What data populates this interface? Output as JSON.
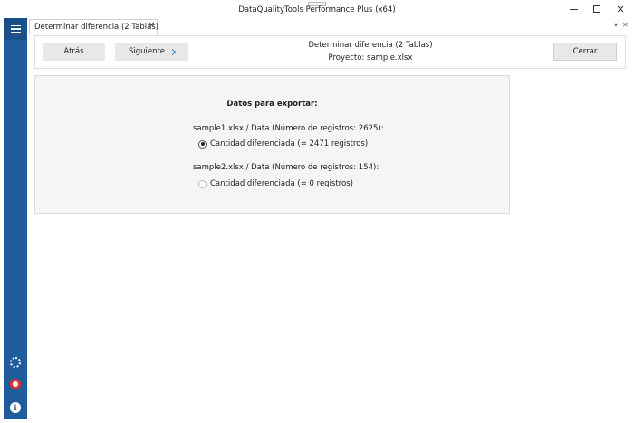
{
  "window": {
    "title": "DataQualityTools Performance Plus (x64)",
    "minimize_label": "",
    "maximize_label": "",
    "close_label": "✕"
  },
  "sidebar": {
    "icons": [
      "menu-icon",
      "gear-icon",
      "help-icon",
      "info-icon"
    ],
    "info_glyph": "i",
    "accent": "#1f5c9c"
  },
  "tabs": [
    {
      "label": "Determinar diferencia (2 Tablas)",
      "close": "✕"
    }
  ],
  "tab_tools": {
    "dropdown": "▾",
    "close": "✕"
  },
  "toolbar": {
    "back_label": "Atrás",
    "next_label": "Siguiente",
    "title": "Determinar diferencia (2 Tablas)",
    "project": "Proyecto: sample.xlsx",
    "close_label": "Cerrar"
  },
  "export": {
    "heading": "Datos para exportar:",
    "file1": "sample1.xlsx / Data (Número de registros: 2625):",
    "option1": "Cantidad diferenciada (= 2471 registros)",
    "file2": "sample2.xlsx / Data (Número de registros: 154):",
    "option2": "Cantidad diferenciada (= 0 registros)"
  }
}
